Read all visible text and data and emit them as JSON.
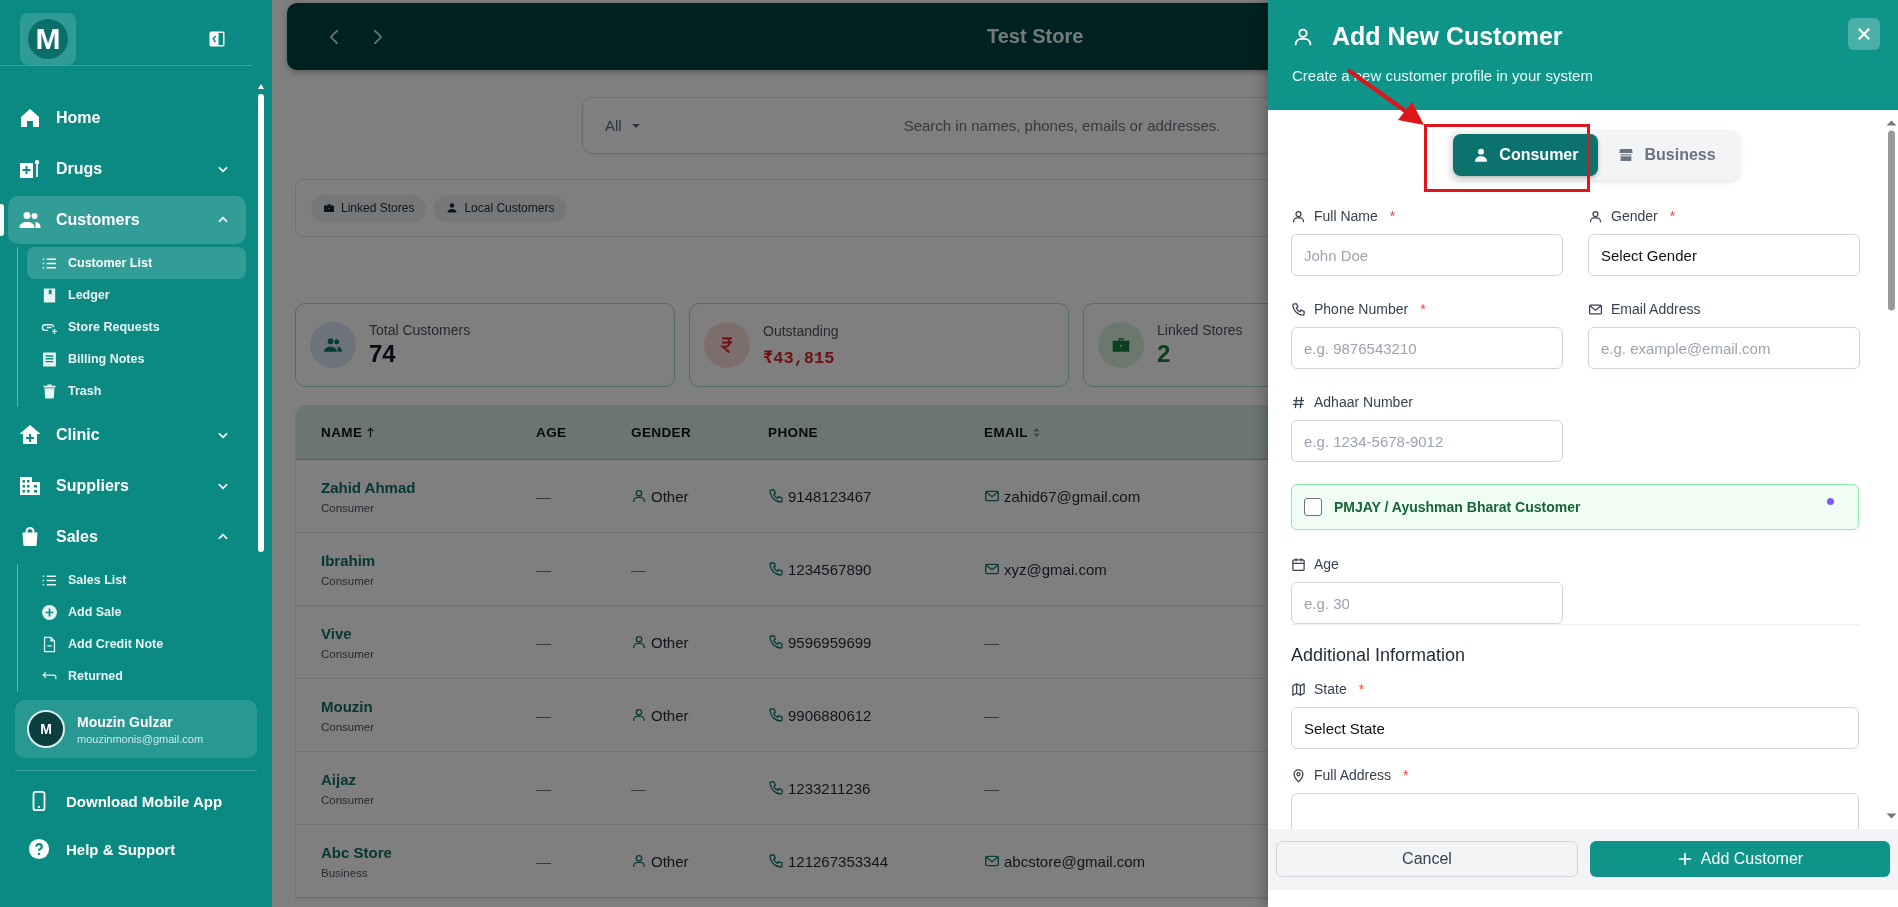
{
  "sidebar": {
    "logo": "M",
    "nav": [
      {
        "kind": "link",
        "label": "Home",
        "selected": false
      },
      {
        "kind": "group",
        "label": "Drugs",
        "selected": false,
        "expanded": false
      },
      {
        "kind": "group",
        "label": "Customers",
        "selected": true,
        "expanded": true,
        "children": [
          {
            "label": "Customer List",
            "selected": true
          },
          {
            "label": "Ledger",
            "selected": false
          },
          {
            "label": "Store Requests",
            "selected": false
          },
          {
            "label": "Billing Notes",
            "selected": false
          },
          {
            "label": "Trash",
            "selected": false
          }
        ]
      },
      {
        "kind": "group",
        "label": "Clinic",
        "selected": false,
        "expanded": false
      },
      {
        "kind": "group",
        "label": "Suppliers",
        "selected": false,
        "expanded": false
      },
      {
        "kind": "group",
        "label": "Sales",
        "selected": false,
        "expanded": true,
        "children": [
          {
            "label": "Sales List",
            "selected": false
          },
          {
            "label": "Add Sale",
            "selected": false
          },
          {
            "label": "Add Credit Note",
            "selected": false
          },
          {
            "label": "Returned",
            "selected": false
          }
        ]
      }
    ],
    "user": {
      "avatar": "M",
      "name": "Mouzin Gulzar",
      "email": "mouzinmonis@gmail.com"
    },
    "links": [
      "Download Mobile App",
      "Help & Support"
    ]
  },
  "main": {
    "title": "Test Store",
    "search": {
      "filter": "All",
      "placeholder": "Search in names, phones, emails or addresses."
    },
    "chips": [
      "Linked Stores",
      "Local Customers"
    ],
    "stats": [
      {
        "kind": "total",
        "label": "Total Customers",
        "value": "74"
      },
      {
        "kind": "due",
        "label": "Outstanding",
        "value": "₹43,815"
      },
      {
        "kind": "linked",
        "label": "Linked Stores",
        "value": "2"
      }
    ],
    "table": {
      "columns": [
        "NAME",
        "AGE",
        "GENDER",
        "PHONE",
        "EMAIL"
      ],
      "rows": [
        {
          "name": "Zahid Ahmad",
          "type": "Consumer",
          "age": "—",
          "gender": "Other",
          "has_gender": true,
          "phone": "9148123467",
          "email": "zahid67@gmail.com",
          "has_email": true
        },
        {
          "name": "Ibrahim",
          "type": "Consumer",
          "age": "—",
          "gender": "—",
          "has_gender": false,
          "phone": "1234567890",
          "email": "xyz@gmai.com",
          "has_email": true
        },
        {
          "name": "Vive",
          "type": "Consumer",
          "age": "—",
          "gender": "Other",
          "has_gender": true,
          "phone": "9596959699",
          "email": "—",
          "has_email": false
        },
        {
          "name": "Mouzin",
          "type": "Consumer",
          "age": "—",
          "gender": "Other",
          "has_gender": true,
          "phone": "9906880612",
          "email": "—",
          "has_email": false
        },
        {
          "name": "Aijaz",
          "type": "Consumer",
          "age": "—",
          "gender": "—",
          "has_gender": false,
          "phone": "1233211236",
          "email": "—",
          "has_email": false
        },
        {
          "name": "Abc Store",
          "type": "Business",
          "age": "—",
          "gender": "Other",
          "has_gender": true,
          "phone": "121267353344",
          "email": "abcstore@gmail.com",
          "has_email": true
        }
      ]
    }
  },
  "drawer": {
    "title": "Add New Customer",
    "subtitle": "Create a new customer profile in your system",
    "type_tabs": [
      {
        "label": "Consumer",
        "selected": true
      },
      {
        "label": "Business",
        "selected": false
      }
    ],
    "fields": [
      {
        "kind": "input",
        "label": "Full Name",
        "required_mark": "*",
        "placeholder": "John Doe"
      },
      {
        "kind": "select",
        "label": "Gender",
        "required_mark": "*",
        "value": "Select Gender"
      },
      {
        "kind": "input",
        "label": "Phone Number",
        "required_mark": "*",
        "placeholder": "e.g. 9876543210"
      },
      {
        "kind": "input",
        "label": "Email Address",
        "placeholder": "e.g. example@email.com"
      },
      {
        "kind": "input",
        "label": "Adhaar Number",
        "placeholder": "e.g. 1234-5678-9012"
      }
    ],
    "pmjay": {
      "label": "PMJAY / Ayushman Bharat Customer",
      "checked": false
    },
    "age": {
      "label": "Age",
      "placeholder": "e.g. 30"
    },
    "section_title": "Additional Information",
    "additional_fields": [
      {
        "kind": "select",
        "label": "State",
        "required_mark": "*",
        "value": "Select State"
      },
      {
        "kind": "input",
        "label": "Full Address",
        "required_mark": "*"
      }
    ],
    "cancel": "Cancel",
    "submit": "Add Customer"
  }
}
